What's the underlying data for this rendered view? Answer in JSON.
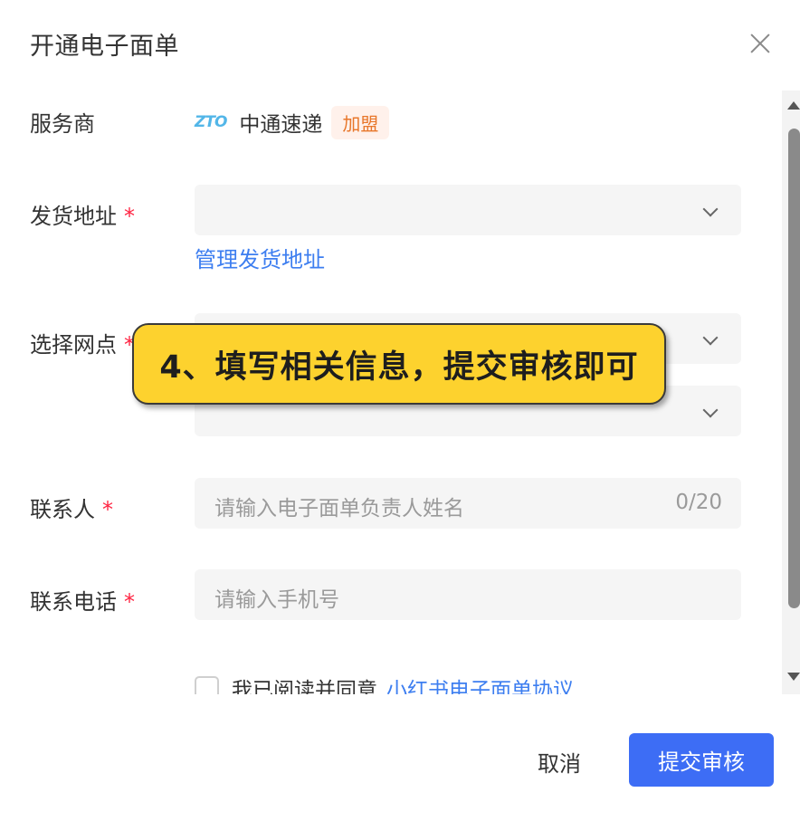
{
  "dialog": {
    "title": "开通电子面单",
    "close_icon": "close-icon"
  },
  "form": {
    "provider": {
      "label": "服务商",
      "logo_text_a": "ZT",
      "logo_text_b": "O",
      "name": "中通速递",
      "tag": "加盟"
    },
    "address": {
      "label": "发货地址",
      "required_mark": "*",
      "value": "",
      "manage_link": "管理发货地址"
    },
    "outlet": {
      "label": "选择网点",
      "required_mark": "*",
      "value_1": "",
      "value_2": ""
    },
    "contact": {
      "label": "联系人",
      "required_mark": "*",
      "placeholder": "请输入电子面单负责人姓名",
      "counter": "0/20"
    },
    "phone": {
      "label": "联系电话",
      "required_mark": "*",
      "placeholder": "请输入手机号"
    },
    "agreement": {
      "text": "我已阅读并同意",
      "link": "小红书电子面单协议",
      "checked": false
    }
  },
  "footer": {
    "cancel_label": "取消",
    "submit_label": "提交审核"
  },
  "callout": {
    "text": "4、填写相关信息，提交审核即可"
  },
  "colors": {
    "accent": "#3d6df5",
    "link": "#3d7ef0",
    "required": "#ff2442",
    "tag_bg": "#fff1eb",
    "tag_text": "#e8772b",
    "callout_bg": "#fdd22e"
  }
}
